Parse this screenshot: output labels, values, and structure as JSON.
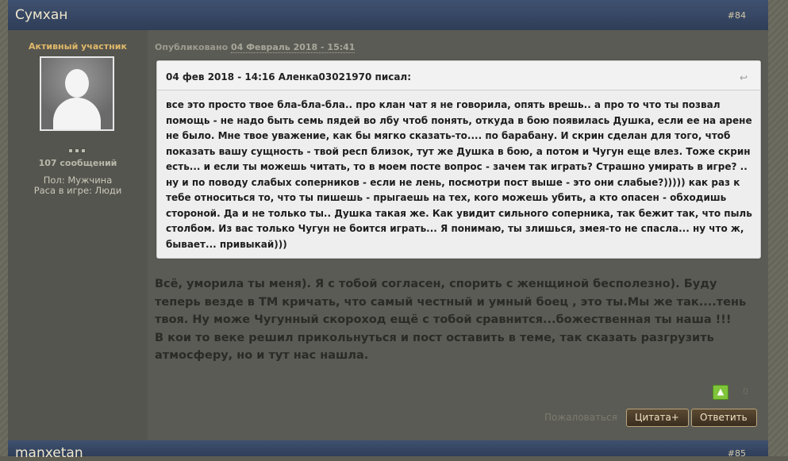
{
  "post": {
    "author": "Сумхан",
    "number": "#84",
    "member_title": "Активный участник",
    "post_count": "107 сообщений",
    "gender": "Пол: Мужчина",
    "race": "Раса в игре: Люди",
    "published_label": "Опубликовано",
    "published_date": "04 Февраль 2018 - 15:41",
    "quote": {
      "cite": "04 фев 2018 - 14:16 Аленка03021970 писал:",
      "text": "все это просто твое бла-бла-бла.. про клан чат я не говорила, опять врешь.. а про то что ты позвал помощь - не надо быть семь пядей во лбу чтоб понять, откуда в бою появилась Душка, если ее на арене не было. Мне твое уважение, как бы мягко сказать-то.... по барабану. И скрин сделан для того, чтоб показать вашу сущность - твой респ близок, тут же Душка в бою, а потом и Чугун еще влез. Тоже скрин есть... и если ты можешь читать, то в моем посте вопрос - зачем так играть? Страшно умирать в игре? .. ну и по поводу слабых соперников - если не лень, посмотри пост выше - это они слабые?))))) как раз к тебе относиться то, что ты пишешь - прыгаешь на тех, кого можешь убить, а кто опасен - обходишь стороной. Да и не только ты.. Душка такая же. Как увидит сильного соперника, так бежит так, что пыль столбом. Из вас только Чугун не боится играть... Я понимаю, ты злишься, змея-то не спасла... ну что ж, бывает... привыкай)))"
    },
    "content_line1": "Всё,  уморила ты меня). Я с тобой согласен, спорить с женщиной бесполезно). Буду теперь везде в ТМ кричать, что самый честный и умный боец , это ты.Мы же так....тень твоя. Ну може Чугунный скороход ещё с тобой сравнится...божественная ты наша !!!",
    "content_line2": "В кои то веке решил прикольнуться и пост оставить в теме, так сказать разгрузить атмосферу, но и тут нас нашла.",
    "reputation": "0",
    "report_label": "Пожаловаться",
    "quote_button": "Цитата+",
    "reply_button": "Ответить"
  },
  "next_post": {
    "author": "manxetan",
    "number": "#85"
  },
  "icons": {
    "rep_up": "arrow-up-icon",
    "quote_link": "quote-link-icon"
  },
  "colors": {
    "header_bg": "#3a4b69",
    "accent_gold": "#e0b96a",
    "quote_bg": "#eeeeee"
  }
}
